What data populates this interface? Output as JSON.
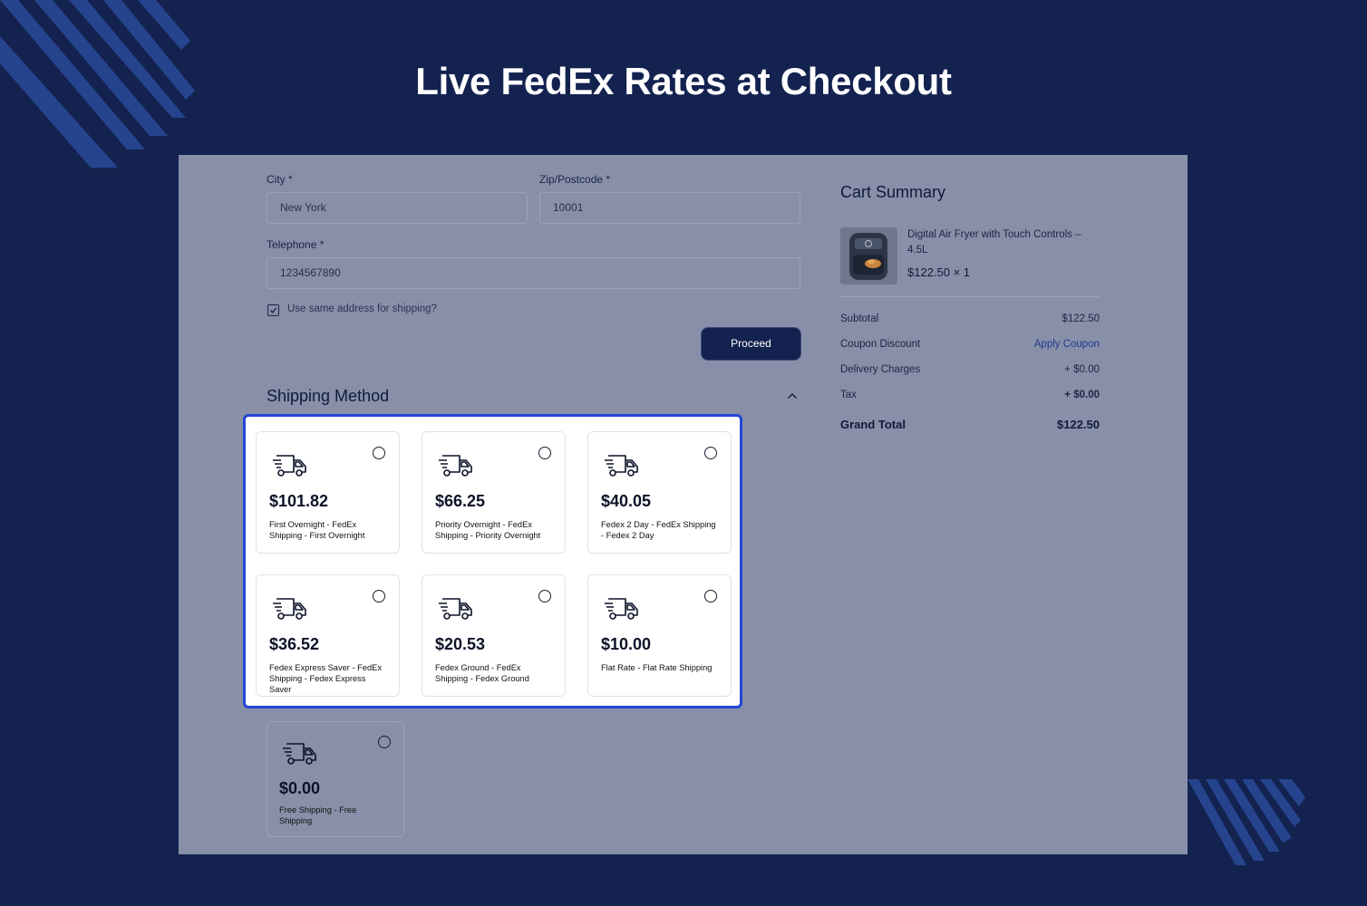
{
  "hero": {
    "title": "Live FedEx Rates at Checkout"
  },
  "form": {
    "city": {
      "label": "City *",
      "value": "New York"
    },
    "zip": {
      "label": "Zip/Postcode *",
      "value": "10001"
    },
    "telephone": {
      "label": "Telephone *",
      "value": "1234567890"
    },
    "same_address": {
      "label": "Use same address for shipping?",
      "checked": true
    },
    "proceed_label": "Proceed"
  },
  "shipping": {
    "title": "Shipping Method",
    "options": [
      {
        "price": "$101.82",
        "desc": "First Overnight - FedEx Shipping - First Overnight"
      },
      {
        "price": "$66.25",
        "desc": "Priority Overnight - FedEx Shipping - Priority Overnight"
      },
      {
        "price": "$40.05",
        "desc": "Fedex 2 Day - FedEx Shipping - Fedex 2 Day"
      },
      {
        "price": "$36.52",
        "desc": "Fedex Express Saver - FedEx Shipping - Fedex Express Saver"
      },
      {
        "price": "$20.53",
        "desc": "Fedex Ground - FedEx Shipping - Fedex Ground"
      },
      {
        "price": "$10.00",
        "desc": "Flat Rate - Flat Rate Shipping"
      },
      {
        "price": "$0.00",
        "desc": "Free Shipping - Free Shipping"
      }
    ]
  },
  "cart": {
    "title": "Cart Summary",
    "item": {
      "name": "Digital Air Fryer with Touch Controls – 4.5L",
      "price_qty": "$122.50 × 1"
    },
    "subtotal": {
      "label": "Subtotal",
      "value": "$122.50"
    },
    "coupon": {
      "label": "Coupon Discount",
      "value": "Apply Coupon"
    },
    "delivery": {
      "label": "Delivery Charges",
      "value": "+ $0.00"
    },
    "tax": {
      "label": "Tax",
      "value": "+ $0.00"
    },
    "grand_total": {
      "label": "Grand Total",
      "value": "$122.50"
    }
  },
  "colors": {
    "background": "#13224f",
    "panel_overlay": "#8790a8",
    "highlight_border": "#2446d8",
    "button": "#13224f"
  },
  "icons": [
    "truck-icon",
    "radio-icon",
    "checkbox-icon",
    "chevron-up-icon",
    "air-fryer-image"
  ]
}
